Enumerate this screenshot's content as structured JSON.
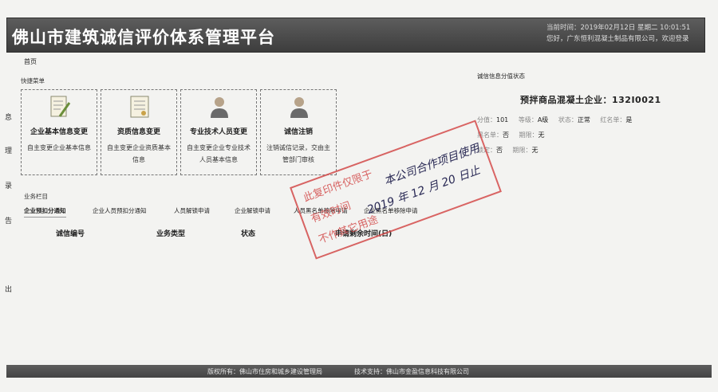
{
  "header": {
    "title": "佛山市建筑诚信评价体系管理平台",
    "time": "当前时间：2019年02月12日 星期二 10:01:51",
    "welcome": "您好，广东恒利混凝土制品有限公司，欢迎登录"
  },
  "left_nav": [
    "息",
    "理",
    "录",
    "告",
    "出"
  ],
  "breadcrumb": "首页",
  "quick_menu": {
    "label": "快捷菜单",
    "items": [
      {
        "name": "企业基本信息变更",
        "desc": "自主变更企业基本信息",
        "icon": "document-pen-icon"
      },
      {
        "name": "资质信息变更",
        "desc": "自主变更企业资质基本信息",
        "icon": "certificate-icon"
      },
      {
        "name": "专业技术人员变更",
        "desc": "自主变更企业专业技术人员基本信息",
        "icon": "person-icon"
      },
      {
        "name": "诚信注销",
        "desc": "注销诚信记录，交由主管部门审核",
        "icon": "person-icon"
      }
    ]
  },
  "business": {
    "label": "业务栏目",
    "tabs": [
      "企业预扣分通知",
      "企业人员预扣分通知",
      "人员解锁申请",
      "企业解锁申请",
      "人员黑名单移除申请",
      "企业黑名单移除申请"
    ],
    "columns": [
      "诚信编号",
      "业务类型",
      "状态",
      "申请剩余时间(日)"
    ]
  },
  "credit": {
    "title": "诚信信息分值状态",
    "company": "预拌商品混凝土企业：132I0021",
    "row1": [
      {
        "k": "分值：",
        "v": "101"
      },
      {
        "k": "等级：",
        "v": "A级"
      },
      {
        "k": "状态：",
        "v": "正常"
      },
      {
        "k": "红名单：",
        "v": "是"
      }
    ],
    "row2": [
      {
        "k": "黑名单：",
        "v": "否"
      },
      {
        "k": "期限：",
        "v": "无"
      }
    ],
    "row3": [
      {
        "k": "锁定：",
        "v": "否"
      },
      {
        "k": "期限：",
        "v": "无"
      }
    ]
  },
  "footer": {
    "copyright": "版权所有：佛山市住房和城乡建设管理局",
    "support": "技术支持：佛山市金盈信息科技有限公司"
  },
  "stamp": {
    "lines": [
      "此复印件仅限于",
      "有效时间",
      "不作其它用途"
    ],
    "hand1": "本公司合作项目使用",
    "hand2": "2019 年 12 月 20 日止"
  },
  "colors": {
    "header_bg": "#4a4a4a",
    "stamp": "#d34a4a",
    "ink": "#2a2a55"
  }
}
